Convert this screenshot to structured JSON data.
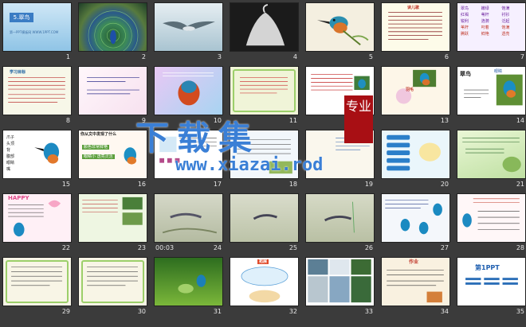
{
  "slides": [
    {
      "num": "1",
      "title": "5.翠鸟",
      "sub": "第一PPT模板网 WWW.1PPT.COM"
    },
    {
      "num": "2"
    },
    {
      "num": "3"
    },
    {
      "num": "4"
    },
    {
      "num": "5"
    },
    {
      "num": "6",
      "title": "读儿歌"
    },
    {
      "num": "7",
      "words": [
        "翠鸟",
        "嫩绿",
        "饱满",
        "红褐",
        "苇杆",
        "衬衫",
        "锐利",
        "涟漪",
        "泛起",
        "苇杆",
        "叼着",
        "饱满",
        "腾跃",
        "鲜艳",
        "透亮",
        "清脆",
        "翠绿",
        "小鸟"
      ]
    },
    {
      "num": "8",
      "title": "学习目标"
    },
    {
      "num": "9"
    },
    {
      "num": "10"
    },
    {
      "num": "11"
    },
    {
      "num": "12"
    },
    {
      "num": "13",
      "title": "羽毛"
    },
    {
      "num": "14",
      "title": "翠鸟",
      "sub": "眼睛"
    },
    {
      "num": "15",
      "labels": [
        "爪子",
        "头顶",
        "背",
        "腹部",
        "眼睛",
        "嘴"
      ]
    },
    {
      "num": "16",
      "title": "你从文中发现了什么",
      "labels": [
        "颜色非常鲜艳",
        "眼睛小 透亮灵活"
      ]
    },
    {
      "num": "17"
    },
    {
      "num": "18"
    },
    {
      "num": "19",
      "seal": "专业"
    },
    {
      "num": "20"
    },
    {
      "num": "21"
    },
    {
      "num": "22",
      "title": "HAPPY"
    },
    {
      "num": "23"
    },
    {
      "num": "24",
      "time": "00:03"
    },
    {
      "num": "25"
    },
    {
      "num": "26"
    },
    {
      "num": "27"
    },
    {
      "num": "28"
    },
    {
      "num": "29"
    },
    {
      "num": "30"
    },
    {
      "num": "31"
    },
    {
      "num": "32",
      "title": "拓展"
    },
    {
      "num": "33"
    },
    {
      "num": "34",
      "title": "作业"
    },
    {
      "num": "35",
      "title": "第1PPT"
    }
  ],
  "watermark": {
    "text": "下载集",
    "url": "www.xiazai.rod",
    "seal": "专业"
  },
  "colors": {
    "background": "#3b3b3b",
    "accent": "#3a7fd6",
    "seal": "#a80f14"
  }
}
